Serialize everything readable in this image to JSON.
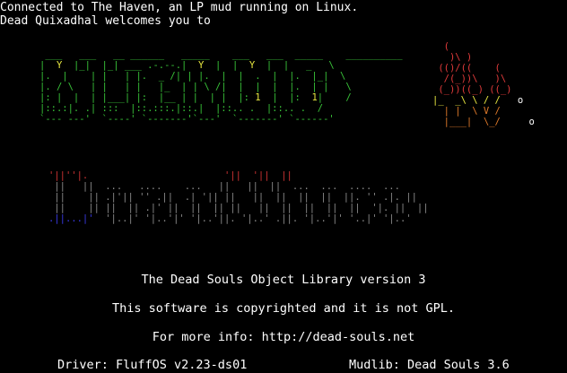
{
  "connection": {
    "connected_line": "Connected to The Haven, an LP mud running on Linux.",
    "welcome_line": "Dead Quixadhal welcomes you to"
  },
  "footer": {
    "library_line": "The Dead Souls Object Library version 3",
    "copyright_line": "This software is copyrighted and it is not GPL.",
    "info_line": "For more info: http://dead-souls.net",
    "driver_line": "Driver: FluffOS v2.23-ds01",
    "mudlib_line": "Mudlib: Dead Souls 3.6"
  },
  "colors": {
    "background": "#000000",
    "text": "#ffffff",
    "logo_green": "#39c439",
    "logo_yellow": "#e8e840",
    "flame_red": "#e23b3b",
    "blood_red": "#d03434",
    "blood_blue": "#3a3ae8",
    "blood_gray": "#8a8a8a"
  }
}
